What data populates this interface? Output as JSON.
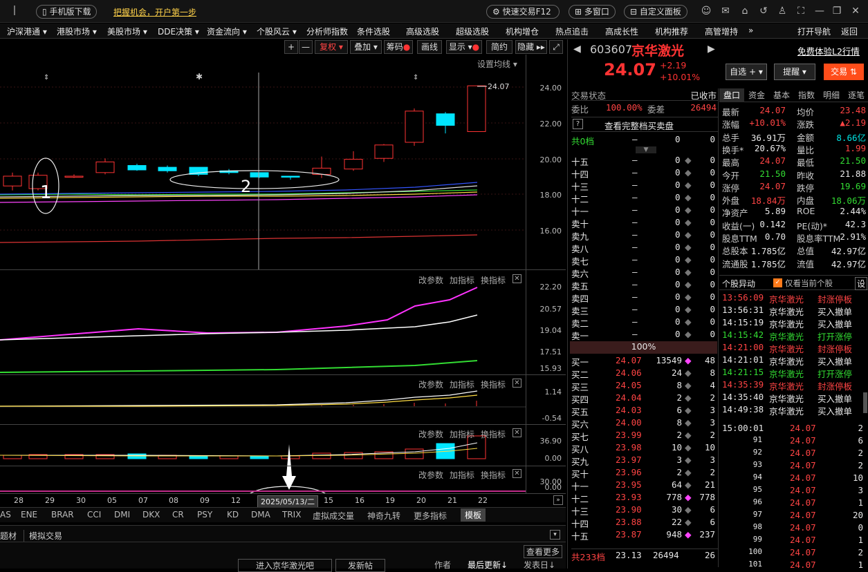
{
  "topbar": {
    "mobile": "手机版下载",
    "slogan": "把握机会，开户第一步",
    "quick_trade": "快速交易F12",
    "multi_window": "多窗口",
    "custom_panel": "自定义面板"
  },
  "menu": [
    "沪深港通 ▾",
    "港股市场 ▾",
    "美股市场 ▾",
    "DDE决策 ▾",
    "资金流向 ▾",
    "个股风云 ▾",
    "分析师指数",
    "条件选股",
    "高级选股",
    "超级选股",
    "机构增仓",
    "热点追击",
    "高成长性",
    "机构推荐",
    "高管增持",
    "»",
    "打开导航",
    "返回"
  ],
  "chart_toolbar": {
    "plus": "+",
    "minus": "—",
    "fq": "复权 ▾",
    "overlay": "叠加 ▾",
    "chips": "筹码",
    "draw": "画线",
    "display": "显示 ▾",
    "simple": "简约",
    "hide": "隐藏 ▸▸",
    "ma_settings": "设置均线 ▾"
  },
  "price_axis": [
    "24.00",
    "22.00",
    "20.00",
    "18.00",
    "16.00"
  ],
  "last_price_tag": "24.07",
  "annotations": {
    "one": "1",
    "two": "2"
  },
  "ind1": {
    "hdr": [
      "改参数",
      "加指标",
      "换指标"
    ],
    "axis": [
      "22.20",
      "20.57",
      "19.04",
      "17.51",
      "15.93"
    ]
  },
  "ind2": {
    "hdr": [
      "改参数",
      "加指标",
      "换指标"
    ],
    "axis": [
      "1.14",
      "-0.54"
    ]
  },
  "ind3": {
    "hdr": [
      "改参数",
      "加指标",
      "换指标"
    ],
    "axis": [
      "36.90",
      "0.00"
    ]
  },
  "ind4": {
    "hdr": [
      "改参数",
      "加指标",
      "换指标"
    ],
    "axis": [
      "30.00",
      "0.00"
    ]
  },
  "dates": [
    "28",
    "29",
    "30",
    "05",
    "07",
    "08",
    "09",
    "12",
    "15",
    "16",
    "19",
    "20",
    "21",
    "22"
  ],
  "crosshair_date": "2025/05/13/二",
  "indicator_tabs": [
    "AS",
    "ENE",
    "BRAR",
    "CCI",
    "DMI",
    "DKX",
    "CR",
    "PSY",
    "KD",
    "DMA",
    "TRIX",
    "虚拟成交量",
    "神奇九转",
    "更多指标",
    "模板"
  ],
  "bottom_tabs": [
    "题材",
    "模拟交易"
  ],
  "bottom_bar": {
    "more": "查看更多",
    "forum": "进入京华激光吧",
    "post": "发新帖",
    "author": "作者",
    "last_update": "最后更新↓",
    "publish": "发表日↓"
  },
  "stock": {
    "code": "603607",
    "name": "京华激光",
    "price": "24.07",
    "chg": "+2.19",
    "pct": "+10.01%",
    "l2": "免费体验L2行情",
    "watch": "自选 + ▾",
    "alert": "提醒 ▾",
    "trade": "交易 ⇅"
  },
  "status": {
    "label": "交易状态",
    "value": "已收市",
    "wb_label": "委比",
    "wb": "100.00%",
    "wc_label": "委差",
    "wc": "26494",
    "full": "查看完整档买卖盘",
    "total0": "共0档",
    "dash": "—",
    "z1": "0",
    "z2": "0"
  },
  "sells": [
    [
      "十五",
      "—",
      "0",
      "0"
    ],
    [
      "十四",
      "—",
      "0",
      "0"
    ],
    [
      "十三",
      "—",
      "0",
      "0"
    ],
    [
      "十二",
      "—",
      "0",
      "0"
    ],
    [
      "十一",
      "—",
      "0",
      "0"
    ],
    [
      "卖十",
      "—",
      "0",
      "0"
    ],
    [
      "卖九",
      "—",
      "0",
      "0"
    ],
    [
      "卖八",
      "—",
      "0",
      "0"
    ],
    [
      "卖七",
      "—",
      "0",
      "0"
    ],
    [
      "卖六",
      "—",
      "0",
      "0"
    ],
    [
      "卖五",
      "—",
      "0",
      "0"
    ],
    [
      "卖四",
      "—",
      "0",
      "0"
    ],
    [
      "卖三",
      "—",
      "0",
      "0"
    ],
    [
      "卖二",
      "—",
      "0",
      "0"
    ],
    [
      "卖一",
      "—",
      "0",
      "0"
    ]
  ],
  "ratio": "100%",
  "buys": [
    [
      "买一",
      "24.07",
      "13549",
      "48"
    ],
    [
      "买二",
      "24.06",
      "24",
      "8"
    ],
    [
      "买三",
      "24.05",
      "8",
      "4"
    ],
    [
      "买四",
      "24.04",
      "2",
      "2"
    ],
    [
      "买五",
      "24.03",
      "6",
      "3"
    ],
    [
      "买六",
      "24.00",
      "8",
      "3"
    ],
    [
      "买七",
      "23.99",
      "2",
      "2"
    ],
    [
      "买八",
      "23.98",
      "10",
      "10"
    ],
    [
      "买九",
      "23.97",
      "3",
      "3"
    ],
    [
      "买十",
      "23.96",
      "2",
      "2"
    ],
    [
      "十一",
      "23.95",
      "64",
      "21"
    ],
    [
      "十二",
      "23.93",
      "778",
      "778"
    ],
    [
      "十三",
      "23.90",
      "30",
      "6"
    ],
    [
      "十四",
      "23.88",
      "22",
      "6"
    ],
    [
      "十五",
      "23.87",
      "948",
      "237"
    ]
  ],
  "buy_total": {
    "label": "共233档",
    "price": "23.13",
    "vol": "26494",
    "n": "26"
  },
  "tabs": [
    "盘口",
    "资金",
    "基本",
    "指数",
    "明细",
    "逐笔"
  ],
  "quote": [
    [
      "最新",
      "24.07",
      "均价",
      "23.48"
    ],
    [
      "涨幅",
      "+10.01%",
      "涨跌",
      "▲2.19"
    ],
    [
      "总手",
      "36.91万",
      "金额",
      "8.66亿"
    ],
    [
      "换手*",
      "20.67%",
      "量比",
      "1.99"
    ],
    [
      "最高",
      "24.07",
      "最低",
      "21.50"
    ],
    [
      "今开",
      "21.50",
      "昨收",
      "21.88"
    ],
    [
      "涨停",
      "24.07",
      "跌停",
      "19.69"
    ],
    [
      "外盘",
      "18.84万",
      "内盘",
      "18.06万"
    ],
    [
      "净资产",
      "5.89",
      "ROE",
      "2.44%"
    ],
    [
      "收益(一)",
      "0.142",
      "PE(动)*",
      "42.3"
    ],
    [
      "股息TTM",
      "0.70",
      "股息率TTM",
      "2.91%"
    ],
    [
      "总股本",
      "1.785亿",
      "总值",
      "42.97亿"
    ],
    [
      "流通股",
      "1.785亿",
      "流值",
      "42.97亿"
    ]
  ],
  "events_hdr": {
    "title": "个股异动",
    "only": "仅看当前个股",
    "set": "设"
  },
  "events": [
    [
      "13:56:09",
      "京华激光",
      "封涨停板"
    ],
    [
      "13:56:31",
      "京华激光",
      "买入撤单"
    ],
    [
      "14:15:19",
      "京华激光",
      "买入撤单"
    ],
    [
      "14:15:42",
      "京华激光",
      "打开涨停"
    ],
    [
      "14:21:00",
      "京华激光",
      "封涨停板"
    ],
    [
      "14:21:01",
      "京华激光",
      "买入撤单"
    ],
    [
      "14:21:15",
      "京华激光",
      "打开涨停"
    ],
    [
      "14:35:39",
      "京华激光",
      "封涨停板"
    ],
    [
      "14:35:40",
      "京华激光",
      "买入撤单"
    ],
    [
      "14:49:38",
      "京华激光",
      "买入撤单"
    ]
  ],
  "ticks": [
    [
      "15:00:01",
      "24.07",
      "2"
    ],
    [
      "91",
      "24.07",
      "6"
    ],
    [
      "92",
      "24.07",
      "2"
    ],
    [
      "93",
      "24.07",
      "2"
    ],
    [
      "94",
      "24.07",
      "10"
    ],
    [
      "95",
      "24.07",
      "3"
    ],
    [
      "96",
      "24.07",
      "1"
    ],
    [
      "97",
      "24.07",
      "20"
    ],
    [
      "98",
      "24.07",
      "0"
    ],
    [
      "99",
      "24.07",
      "1"
    ],
    [
      "100",
      "24.07",
      "2"
    ],
    [
      "101",
      "24.07",
      "1"
    ]
  ],
  "colors": {
    "up": "#ff3333",
    "down": "#00e5ff",
    "ma5": "#e0e0e0",
    "ma10": "#ffdd44",
    "ma20": "#ff44ff",
    "ma30": "#33dd33",
    "ma60": "#3355ff",
    "ma120": "#dd3333"
  }
}
